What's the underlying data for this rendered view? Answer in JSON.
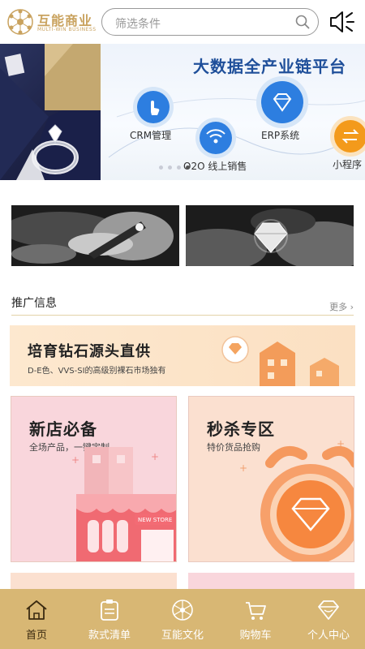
{
  "header": {
    "logo_title": "互能商业",
    "logo_subtitle": "MULTI-WIN BUSINESS",
    "search_placeholder": "筛选条件",
    "icons": [
      "logo-icon",
      "search-icon",
      "speaker-icon"
    ]
  },
  "banner": {
    "title": "大数据全产业链平台",
    "items": [
      {
        "label": "CRM管理",
        "icon": "hand-tap-icon"
      },
      {
        "label": "O2O 线上销售",
        "icon": "wifi-icon"
      },
      {
        "label": "ERP系统",
        "icon": "diamond-icon"
      },
      {
        "label": "小程序",
        "icon": "swap-icon"
      }
    ],
    "slide_count": 4,
    "active_slide": 3
  },
  "section": {
    "title": "推广信息",
    "more": "更多 ›"
  },
  "promo": {
    "title": "培育钻石源头直供",
    "subtitle": "D-E色、VVS-SI的高级别裸石市场独有"
  },
  "cards": [
    {
      "title": "新店必备",
      "subtitle": "全场产品，一键定制",
      "badge": "NEW STORE",
      "color": "#f9d6dc"
    },
    {
      "title": "秒杀专区",
      "subtitle": "特价货品抢购",
      "color": "#fbe0d0"
    }
  ],
  "nav": {
    "items": [
      {
        "label": "首页",
        "icon": "home-icon",
        "active": true
      },
      {
        "label": "款式清单",
        "icon": "clipboard-icon",
        "active": false
      },
      {
        "label": "互能文化",
        "icon": "network-icon",
        "active": false
      },
      {
        "label": "购物车",
        "icon": "cart-icon",
        "active": false
      },
      {
        "label": "个人中心",
        "icon": "diamond-user-icon",
        "active": false
      }
    ]
  },
  "colors": {
    "accent_gold": "#d8b774",
    "banner_blue": "#1f4f9a",
    "promo_bg": "#fde8cf"
  }
}
